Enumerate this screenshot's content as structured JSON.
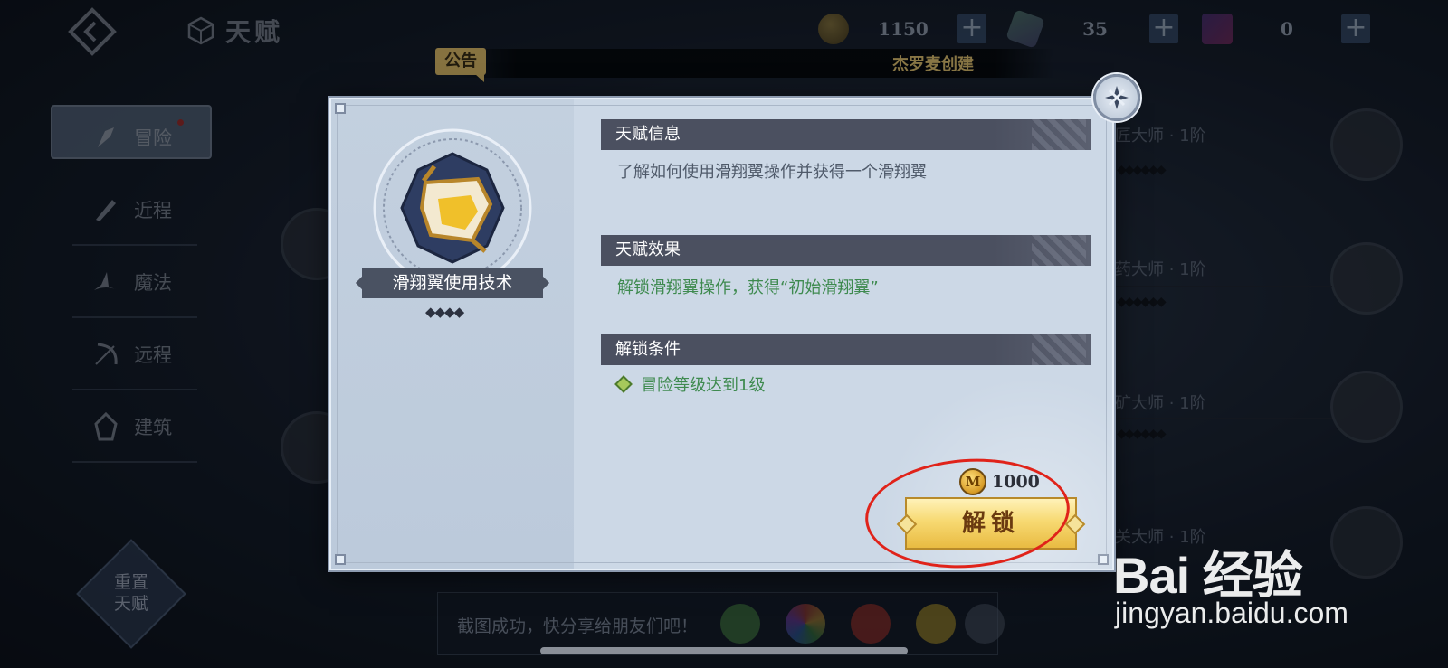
{
  "header": {
    "title": "天赋",
    "resources": [
      {
        "icon": "gold-coin-icon",
        "value": "1150"
      },
      {
        "icon": "crystal-icon",
        "value": "35"
      },
      {
        "icon": "cube-gem-icon",
        "value": "0"
      }
    ],
    "plus_label": "+"
  },
  "notice": {
    "tag": "公告",
    "text": "杰罗麦创建"
  },
  "sidebar": {
    "items": [
      {
        "label": "冒险",
        "icon": "adventure-icon",
        "active": true,
        "badge": true
      },
      {
        "label": "近程",
        "icon": "melee-icon"
      },
      {
        "label": "魔法",
        "icon": "magic-hat-icon"
      },
      {
        "label": "远程",
        "icon": "bow-icon"
      },
      {
        "label": "建筑",
        "icon": "building-icon"
      }
    ],
    "reset_label_line1": "重置",
    "reset_label_line2": "天赋"
  },
  "background_tree": {
    "labels": [
      "匠大师 · 1阶",
      "药大师 · 1阶",
      "矿大师 · 1阶",
      "关大师 · 1阶"
    ],
    "rank_glyphs": "◆◆◆◆◆◆"
  },
  "modal": {
    "talent_name": "滑翔翼使用技术",
    "rank_glyphs": "◆◆◆◆",
    "sections": {
      "info_title": "天赋信息",
      "info_text": "了解如何使用滑翔翼操作并获得一个滑翔翼",
      "effect_title": "天赋效果",
      "effect_text": "解锁滑翔翼操作，获得“初始滑翔翼”",
      "condition_title": "解锁条件",
      "condition_text": "冒险等级达到1级"
    },
    "cost": {
      "coin_letter": "M",
      "amount": "1000"
    },
    "unlock_label": "解锁"
  },
  "share_bar": {
    "text": "截图成功，快分享给朋友们吧！",
    "icons": [
      "wechat-icon",
      "moments-icon",
      "weibo-icon",
      "qzone-icon",
      "close-icon"
    ]
  },
  "watermark": {
    "logo": "Bai 经验",
    "url": "jingyan.baidu.com"
  },
  "colors": {
    "accent_gold": "#f0c96a",
    "effect_green": "#3e8a4f",
    "highlight_red": "#e0231a"
  }
}
